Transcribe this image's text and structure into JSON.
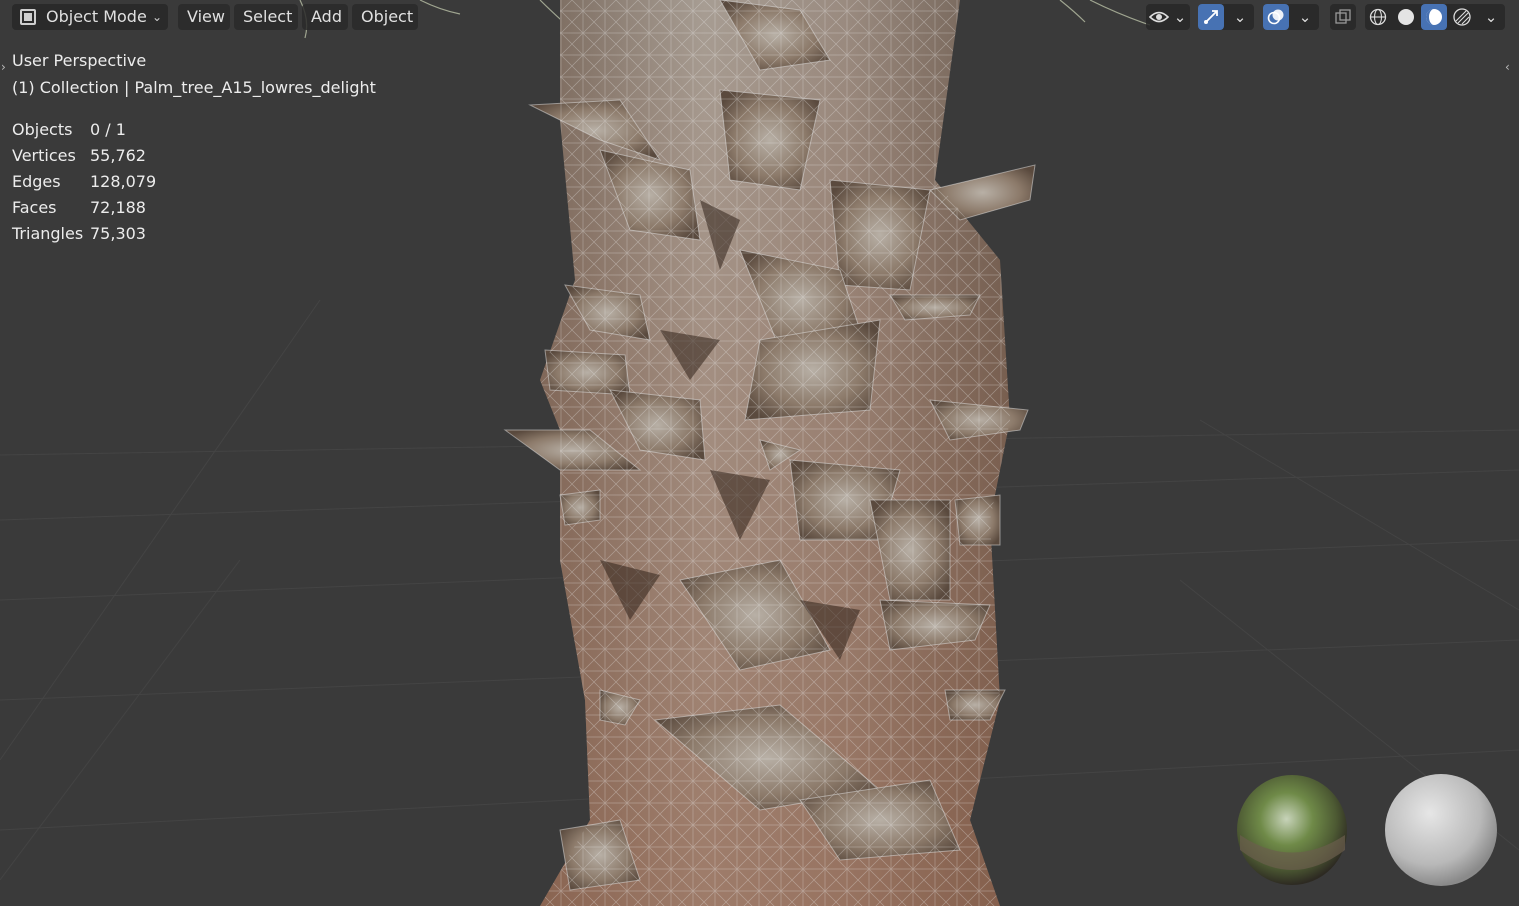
{
  "header": {
    "mode_label": "Object Mode",
    "menus": [
      "View",
      "Select",
      "Add",
      "Object"
    ]
  },
  "overlay": {
    "view_name": "User Perspective",
    "collection": "(1) Collection | Palm_tree_A15_lowres_delight",
    "stats": [
      {
        "label": "Objects",
        "value": "0 / 1"
      },
      {
        "label": "Vertices",
        "value": "55,762"
      },
      {
        "label": "Edges",
        "value": "128,079"
      },
      {
        "label": "Faces",
        "value": "72,188"
      },
      {
        "label": "Triangles",
        "value": "75,303"
      }
    ]
  },
  "icons": {
    "visibility": "eye-icon",
    "gizmo": "gizmo-icon",
    "overlays": "overlays-icon",
    "xray": "xray-icon",
    "shading": [
      "wireframe-shading-icon",
      "solid-shading-icon",
      "material-preview-icon",
      "rendered-shading-icon"
    ]
  },
  "colors": {
    "background": "#3a3a3a",
    "accent": "#4772b3",
    "header_button": "#282828"
  }
}
